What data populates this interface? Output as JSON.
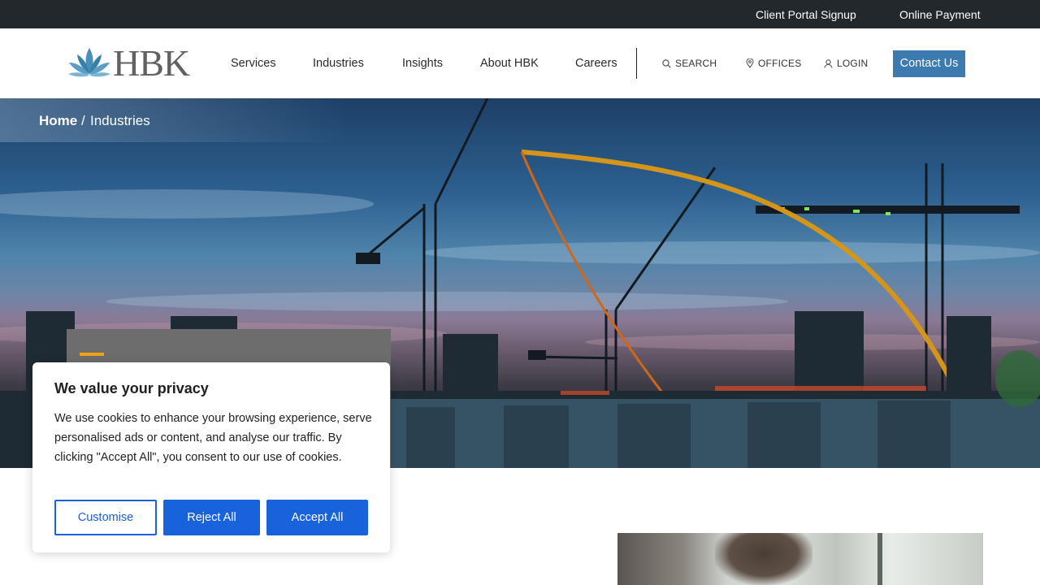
{
  "topbar": {
    "links": [
      "Client Portal Signup",
      "Online Payment"
    ]
  },
  "header": {
    "logo_text": "HBK",
    "nav": [
      "Services",
      "Industries",
      "Insights",
      "About HBK",
      "Careers"
    ],
    "utility": {
      "search": "SEARCH",
      "offices": "OFFICES",
      "login": "LOGIN"
    },
    "contact_label": "Contact Us",
    "colors": {
      "accent": "#3d7ab0",
      "topbar": "#23282d"
    }
  },
  "breadcrumb": {
    "home": "Home",
    "separator": "/",
    "current": "Industries"
  },
  "hero": {
    "accent_color": "#f0a11a"
  },
  "cookie_banner": {
    "title": "We value your privacy",
    "text": "We use cookies to enhance your browsing experience, serve personalised ads or content, and analyse our traffic. By clicking \"Accept All\", you consent to our use of cookies.",
    "customise_label": "Customise",
    "reject_label": "Reject All",
    "accept_label": "Accept All",
    "button_color": "#1863dc"
  }
}
